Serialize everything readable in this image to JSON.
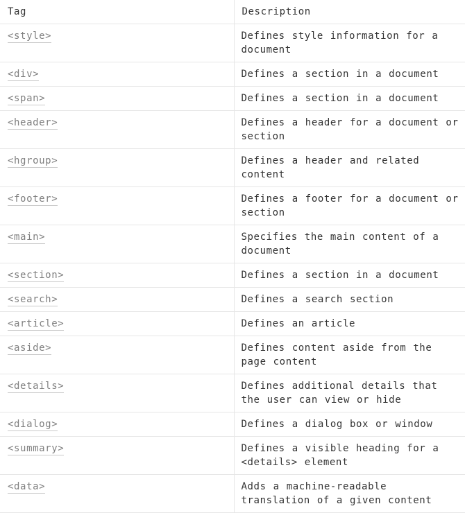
{
  "table": {
    "headers": {
      "tag": "Tag",
      "description": "Description"
    },
    "rows": [
      {
        "tag": "<style>",
        "description": "Defines style information for a document"
      },
      {
        "tag": "<div>",
        "description": "Defines a section in a document"
      },
      {
        "tag": "<span>",
        "description": "Defines a section in a document"
      },
      {
        "tag": "<header>",
        "description": "Defines a header for a document or section"
      },
      {
        "tag": "<hgroup>",
        "description": "Defines a header and related content"
      },
      {
        "tag": "<footer>",
        "description": "Defines a footer for a document or section"
      },
      {
        "tag": "<main>",
        "description": "Specifies the main content of a document"
      },
      {
        "tag": "<section>",
        "description": "Defines a section in a document"
      },
      {
        "tag": "<search>",
        "description": "Defines a search section"
      },
      {
        "tag": "<article>",
        "description": "Defines an article"
      },
      {
        "tag": "<aside>",
        "description": "Defines content aside from the page content"
      },
      {
        "tag": "<details>",
        "description": "Defines additional details that the user can view or hide"
      },
      {
        "tag": "<dialog>",
        "description": "Defines a dialog box or window"
      },
      {
        "tag": "<summary>",
        "description": "Defines a visible heading for a <details> element"
      },
      {
        "tag": "<data>",
        "description": "Adds a machine-readable translation of a given content"
      }
    ]
  }
}
